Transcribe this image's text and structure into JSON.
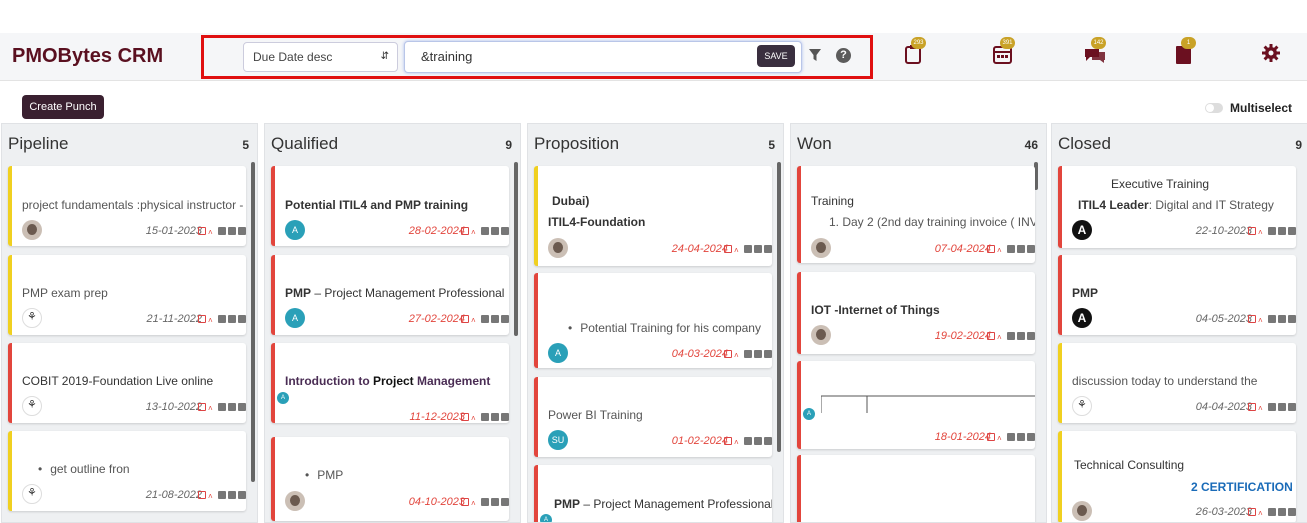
{
  "brand": "PMOBytes CRM",
  "search": {
    "sort_value": "Due Date desc",
    "query": "&training",
    "save_label": "SAVE"
  },
  "nav_badges": {
    "b1": "293",
    "b2": "391",
    "b3": "142",
    "b4": "1"
  },
  "actions": {
    "create_punch": "Create Punch",
    "multiselect": "Multiselect"
  },
  "columns": [
    {
      "title": "Pipeline",
      "count": "5",
      "cards": [
        {
          "lines": [
            "project fundamentals :physical instructor -"
          ],
          "date": "15-01-2023"
        },
        {
          "lines": [
            "PMP exam prep"
          ],
          "date": "21-11-2022"
        },
        {
          "lines": [
            "COBIT 2019-Foundation Live online"
          ],
          "date": "13-10-2022"
        },
        {
          "lines": [
            "get outline fron"
          ],
          "date": "21-08-2022"
        }
      ]
    },
    {
      "title": "Qualified",
      "count": "9",
      "cards": [
        {
          "lines": [
            "Potential ITIL4 and PMP training"
          ],
          "date": "28-02-2024",
          "avatar": "A"
        },
        {
          "lines": [
            "PMP",
            " – Project Management Professional"
          ],
          "date": "27-02-2024",
          "avatar": "A"
        },
        {
          "lines": [
            "Introduction to ",
            "Project",
            " Management"
          ],
          "date": "11-12-2023",
          "avatar": "A"
        },
        {
          "lines": [
            "PMP"
          ],
          "date": "04-10-2023"
        }
      ]
    },
    {
      "title": "Proposition",
      "count": "5",
      "cards": [
        {
          "lines": [
            "Dubai)",
            "ITIL4-Foundation"
          ],
          "date": "24-04-2024"
        },
        {
          "lines": [
            "Potential Training for his company"
          ],
          "date": "04-03-2024",
          "avatar": "A"
        },
        {
          "lines": [
            "Power BI Training"
          ],
          "date": "01-02-2024",
          "avatar": "SU"
        },
        {
          "lines": [
            "PMP",
            " – Project Management Professional"
          ],
          "avatar": "A"
        }
      ]
    },
    {
      "title": "Won",
      "count": "46",
      "cards": [
        {
          "lines": [
            "Training",
            "1. Day 2 (2nd day training invoice ( INV"
          ],
          "date": "07-04-2024"
        },
        {
          "lines": [
            "IOT -Internet of Things"
          ],
          "date": "19-02-2024"
        },
        {
          "lines": [],
          "date": "18-01-2024",
          "avatar": "A"
        },
        {
          "lines": []
        }
      ]
    },
    {
      "title": "Closed",
      "count": "9",
      "cards": [
        {
          "lines": [
            "Executive Training",
            "ITIL4 Leader",
            ": Digital and IT Strategy"
          ],
          "date": "22-10-2023",
          "avatar": "A"
        },
        {
          "lines": [
            "PMP"
          ],
          "date": "04-05-2023",
          "avatar": "A"
        },
        {
          "lines": [
            "discussion today to understand the"
          ],
          "date": "04-04-2023"
        },
        {
          "lines": [
            "Technical Consulting",
            "2 CERTIFICATION /"
          ],
          "date": "26-03-2023"
        }
      ]
    }
  ]
}
